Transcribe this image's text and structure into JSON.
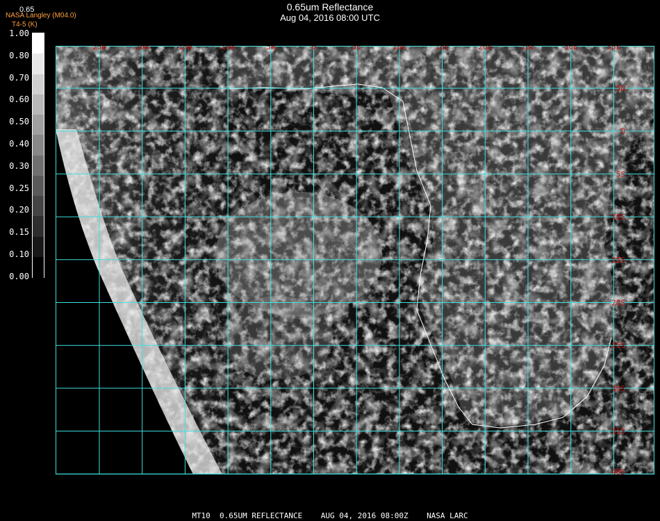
{
  "header": {
    "title": "0.65um Reflectance",
    "datetime": "Aug 04, 2016 08:00 UTC",
    "credit": "NASA Langley (M04.0)",
    "credit_sub": "T4-5 (K)",
    "top_value": "0.65"
  },
  "colorbar": {
    "labels": [
      "1.00",
      "0.80",
      "0.70",
      "0.60",
      "0.50",
      "0.40",
      "0.30",
      "0.25",
      "0.20",
      "0.15",
      "0.10",
      "0.00"
    ],
    "colors": [
      "#ffffff",
      "#e8e8e8",
      "#d0d0d0",
      "#b8b8b8",
      "#a0a0a0",
      "#888888",
      "#707070",
      "#5a5a5a",
      "#444444",
      "#2e2e2e",
      "#181818",
      "#000000"
    ]
  },
  "grid": {
    "lon_labels": [
      "25W",
      "20W",
      "15W",
      "10W",
      "5W",
      "0",
      "5E",
      "10E",
      "15E",
      "20E",
      "25E",
      "30E",
      "35E"
    ],
    "lat_labels": [
      "5N",
      "0",
      "5S",
      "10S",
      "15S",
      "20S",
      "25S",
      "30S",
      "35S",
      "40S"
    ],
    "line_color": "#3fe0e0",
    "label_color": "#c81010"
  },
  "footer": {
    "caption": "MT10  0.65UM REFLECTANCE    AUG 04, 2016 08:00Z    NASA LARC"
  }
}
